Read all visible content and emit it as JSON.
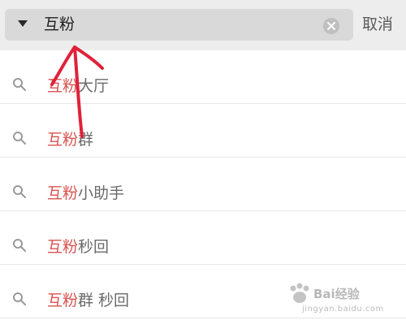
{
  "search": {
    "value": "互粉",
    "cancel_label": "取消"
  },
  "results": [
    {
      "highlight": "互粉",
      "rest": "大厅"
    },
    {
      "highlight": "互粉",
      "rest": "群"
    },
    {
      "highlight": "互粉",
      "rest": "小助手"
    },
    {
      "highlight": "互粉",
      "rest": "秒回"
    },
    {
      "highlight": "互粉",
      "rest": "群 秒回"
    }
  ],
  "watermark": {
    "logo_text": "Bai经验",
    "url": "jingyan.baidu.com"
  },
  "colors": {
    "highlight": "#d9534f",
    "annotation_arrow": "#e0213a"
  }
}
